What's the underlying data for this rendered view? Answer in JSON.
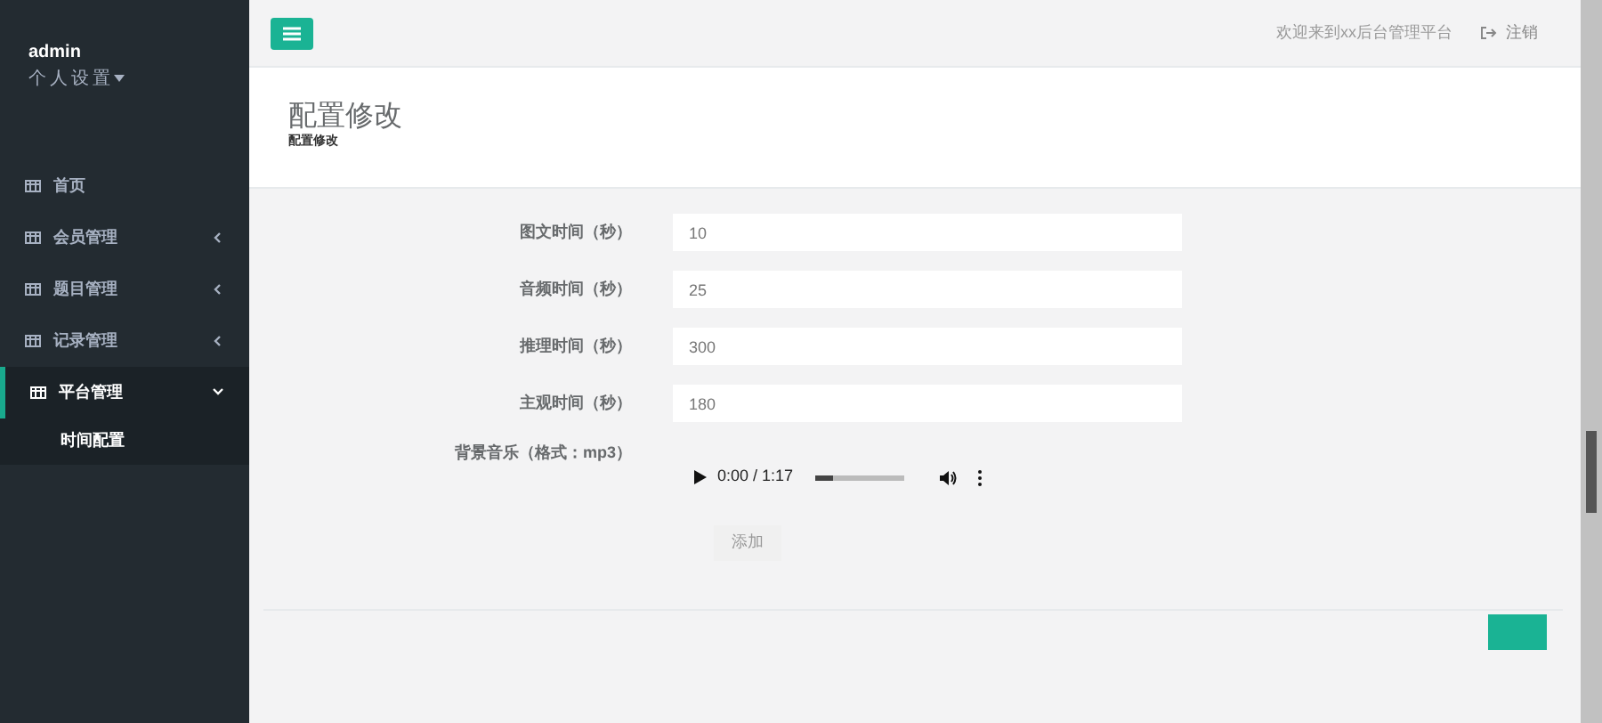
{
  "sidebar": {
    "user": "admin",
    "profile_menu": "个人设置",
    "items": [
      {
        "label": "首页",
        "expanded": false,
        "has_children": false
      },
      {
        "label": "会员管理",
        "expanded": false,
        "has_children": true
      },
      {
        "label": "题目管理",
        "expanded": false,
        "has_children": true
      },
      {
        "label": "记录管理",
        "expanded": false,
        "has_children": true
      },
      {
        "label": "平台管理",
        "expanded": true,
        "has_children": true,
        "children": [
          {
            "label": "时间配置",
            "selected": true
          }
        ]
      }
    ]
  },
  "topbar": {
    "welcome": "欢迎来到xx后台管理平台",
    "logout": "注销"
  },
  "page": {
    "title": "配置修改",
    "breadcrumb": "配置修改"
  },
  "form": {
    "fields": [
      {
        "label": "图文时间（秒）",
        "value": "10"
      },
      {
        "label": "音频时间（秒）",
        "value": "25"
      },
      {
        "label": "推理时间（秒）",
        "value": "300"
      },
      {
        "label": "主观时间（秒）",
        "value": "180"
      }
    ],
    "audio": {
      "label": "背景音乐（格式：mp3）",
      "time": "0:00 / 1:17",
      "level": 0.2
    },
    "submit": "添加"
  }
}
